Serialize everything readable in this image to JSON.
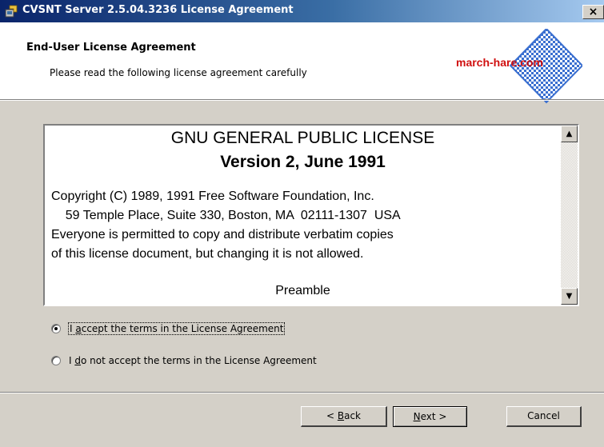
{
  "window": {
    "title": "CVSNT Server 2.5.04.3236 License Agreement",
    "close_symbol": "×"
  },
  "header": {
    "title": "End-User License Agreement",
    "subtitle": "Please read the following license agreement carefully",
    "logo_text": "march-hare.com"
  },
  "license": {
    "title": "GNU GENERAL PUBLIC LICENSE",
    "version": "Version 2, June 1991",
    "lines": [
      "Copyright (C) 1989, 1991 Free Software Foundation, Inc.",
      "    59 Temple Place, Suite 330, Boston, MA  02111-1307  USA",
      "Everyone is permitted to copy and distribute verbatim copies",
      "of this license document, but changing it is not allowed."
    ],
    "preamble": "Preamble"
  },
  "options": {
    "accept": {
      "pre": "I ",
      "key": "a",
      "post": "ccept the terms in the License Agreement",
      "selected": true
    },
    "decline": {
      "pre": "I ",
      "key": "d",
      "post": "o not accept the terms in the License Agreement",
      "selected": false
    }
  },
  "buttons": {
    "back": {
      "pre": "< ",
      "key": "B",
      "post": "ack"
    },
    "next": {
      "pre": "",
      "key": "N",
      "post": "ext >"
    },
    "cancel": "Cancel"
  },
  "icons": {
    "app": "installer-icon",
    "scroll_up": "arrow-up-icon",
    "scroll_down": "arrow-down-icon"
  },
  "colors": {
    "titlebar_start": "#0a246a",
    "titlebar_end": "#a6caf0",
    "logo_red": "#d01010",
    "logo_blue": "#3a6fd0",
    "dialog_bg": "#d4d0c8"
  }
}
